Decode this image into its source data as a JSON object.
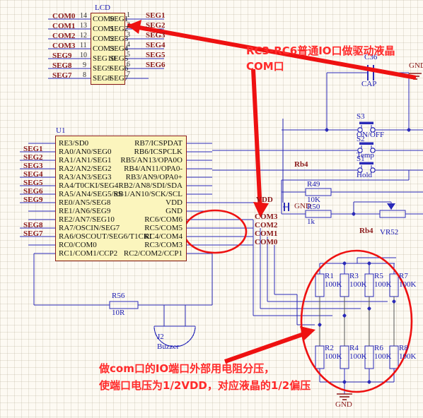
{
  "sheet": {
    "background": "#fdfaf3",
    "wire_color": "#2a2ab8",
    "body_fill": "#fbf5bd",
    "body_border": "#8b1a1a",
    "net_label_color": "#8b1a1a",
    "annotation_color": "#ff2a2a",
    "refdes_color": "#1a1ab4"
  },
  "annotations": [
    {
      "id": "note-top",
      "text_line1": "RC3-RC6普通IO口做驱动液晶",
      "text_line2": "COM口"
    },
    {
      "id": "note-bottom",
      "text_line1": "做com口的IO端口外部用电阻分压，",
      "text_line2": "使端口电压为1/2VDD，对应液晶的1/2偏压"
    }
  ],
  "lcd": {
    "refdes": "LCD",
    "left_pins": [
      {
        "net": "COM0",
        "num": "14",
        "name": "COM0"
      },
      {
        "net": "COM1",
        "num": "13",
        "name": "COM1"
      },
      {
        "net": "COM2",
        "num": "12",
        "name": "COM2"
      },
      {
        "net": "COM3",
        "num": "11",
        "name": "COM3"
      },
      {
        "net": "SEG9",
        "num": "10",
        "name": "SEG10"
      },
      {
        "net": "SEG8",
        "num": "9",
        "name": "SEG9"
      },
      {
        "net": "SEG7",
        "num": "8",
        "name": "SEG8"
      }
    ],
    "right_pins": [
      {
        "name": "SEG1",
        "num": "1",
        "net": "SEG1"
      },
      {
        "name": "SEG2",
        "num": "2",
        "net": "SEG2"
      },
      {
        "name": "SEG3",
        "num": "3",
        "net": "SEG3"
      },
      {
        "name": "SEG4",
        "num": "4",
        "net": "SEG4"
      },
      {
        "name": "SEG5",
        "num": "5",
        "net": "SEG5"
      },
      {
        "name": "SEG6",
        "num": "6",
        "net": "SEG6"
      },
      {
        "name": "SEG7",
        "num": "7",
        "net": ""
      }
    ]
  },
  "u1": {
    "refdes": "U1",
    "left_pins": [
      {
        "name": "RE3/SD0",
        "net": ""
      },
      {
        "name": "RA0/AN0/SEG0",
        "net": "SEG1"
      },
      {
        "name": "RA1/AN1/SEG1",
        "net": "SEG2"
      },
      {
        "name": "RA2/AN2/SEG2",
        "net": "SEG3"
      },
      {
        "name": "RA3/AN3/SEG3",
        "net": "SEG4"
      },
      {
        "name": "RA4/T0CKI/SEG4",
        "net": "SEG5"
      },
      {
        "name": "RA5/AN4/SEG5/SS",
        "net": "SEG6"
      },
      {
        "name": "RE0/AN5/SEG8",
        "net": "SEG9"
      },
      {
        "name": "RE1/AN6/SEG9",
        "net": ""
      },
      {
        "name": "RE2/AN7/SEG10",
        "net": ""
      },
      {
        "name": "RA7/OSCIN/SEG7",
        "net": "SEG8"
      },
      {
        "name": "RA6/OSCOUT/SEG6/T1CKI",
        "net": "SEG7"
      },
      {
        "name": "RC0/COM0",
        "net": ""
      },
      {
        "name": "RC1/COM1/CCP2",
        "net": ""
      }
    ],
    "right_pins": [
      {
        "name": "RB7/ICSPDAT",
        "net": ""
      },
      {
        "name": "RB6/ICSPCLK",
        "net": ""
      },
      {
        "name": "RB5/AN13/OPA0O",
        "net": ""
      },
      {
        "name": "RB4/AN11/OPA0-",
        "net": ""
      },
      {
        "name": "RB3/AN9/OPA0+",
        "net": ""
      },
      {
        "name": "RB2/AN8/SDI/SDA",
        "net": ""
      },
      {
        "name": "RB1/AN10/SCK/SCL",
        "net": ""
      },
      {
        "name": "VDD",
        "net": "VDD"
      },
      {
        "name": "GND",
        "net": ""
      },
      {
        "name": "RC6/COM6",
        "net": "COM3"
      },
      {
        "name": "RC5/COM5",
        "net": "COM2"
      },
      {
        "name": "RC4/COM4",
        "net": "COM1"
      },
      {
        "name": "RC3/COM3",
        "net": "COM0"
      },
      {
        "name": "RC2/COM2/CCP1",
        "net": ""
      }
    ]
  },
  "components": {
    "c36": {
      "refdes": "C36",
      "value": "CAP"
    },
    "s3": {
      "refdes": "S3",
      "value": "ON/OFF"
    },
    "s2": {
      "refdes": "S2",
      "value": "Temp"
    },
    "s1": {
      "refdes": "S1",
      "value": "Hold"
    },
    "r49": {
      "refdes": "R49",
      "value": "10K"
    },
    "r50": {
      "refdes": "R50",
      "value": "1k"
    },
    "vr52": {
      "refdes": "VR52",
      "value": ""
    },
    "r56": {
      "refdes": "R56",
      "value": "10R"
    },
    "j2": {
      "refdes": "J2",
      "value": "Buzzer"
    },
    "divider": [
      {
        "refdes": "R1",
        "value": "100K"
      },
      {
        "refdes": "R3",
        "value": "100K"
      },
      {
        "refdes": "R5",
        "value": "100K"
      },
      {
        "refdes": "R7",
        "value": "100K"
      },
      {
        "refdes": "R2",
        "value": "100K"
      },
      {
        "refdes": "R4",
        "value": "100K"
      },
      {
        "refdes": "R6",
        "value": "100K"
      },
      {
        "refdes": "R8",
        "value": "100K"
      }
    ]
  },
  "net_labels": {
    "rb4_upper": "Rb4",
    "rb4_lower": "Rb4",
    "gnd_mid": "GND",
    "gnd_topright": "GND",
    "gnd_bottom": "GND"
  }
}
